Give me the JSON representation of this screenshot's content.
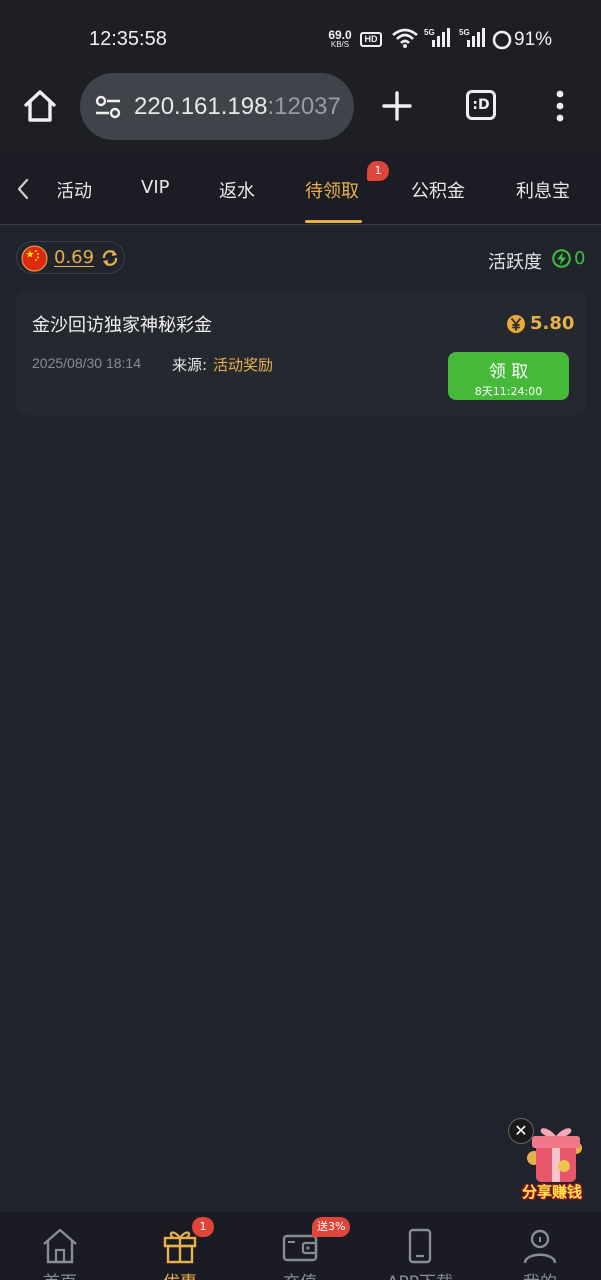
{
  "status_bar": {
    "time": "12:35:58",
    "net_speed_value": "69.0",
    "net_speed_unit": "KB/S",
    "hd_label": "HD",
    "signal_1_label": "5G",
    "signal_2_label": "5G",
    "battery": "91%"
  },
  "browser": {
    "url_main": "220.161.198",
    "url_port": ":12037",
    "tabs_label": ":D"
  },
  "category_tabs": {
    "items": [
      {
        "label": "活动"
      },
      {
        "label": "VIP"
      },
      {
        "label": "返水"
      },
      {
        "label": "待领取",
        "badge": "1"
      },
      {
        "label": "公积金"
      },
      {
        "label": "利息宝"
      }
    ],
    "active_index": 3
  },
  "balance": {
    "value": "0.69",
    "activity_label": "活跃度",
    "activity_value": "0"
  },
  "reward": {
    "title": "金沙回访独家神秘彩金",
    "amount": "5.80",
    "date": "2025/08/30 18:14",
    "source_label": "来源:",
    "source_value": "活动奖励",
    "claim_label": "领 取",
    "claim_timer": "8天11:24:00"
  },
  "promo": {
    "label": "分享赚钱",
    "close": "✕"
  },
  "bottom_nav": {
    "items": [
      {
        "label": "首页"
      },
      {
        "label": "优惠",
        "badge": "1"
      },
      {
        "label": "充值",
        "badge": "送3%"
      },
      {
        "label": "APP下载"
      },
      {
        "label": "我的"
      }
    ],
    "active_index": 1
  },
  "colors": {
    "background": "#20222c",
    "accent_gold": "#e8b04a",
    "claim_green": "#46b83a",
    "badge_red": "#e0453a"
  }
}
